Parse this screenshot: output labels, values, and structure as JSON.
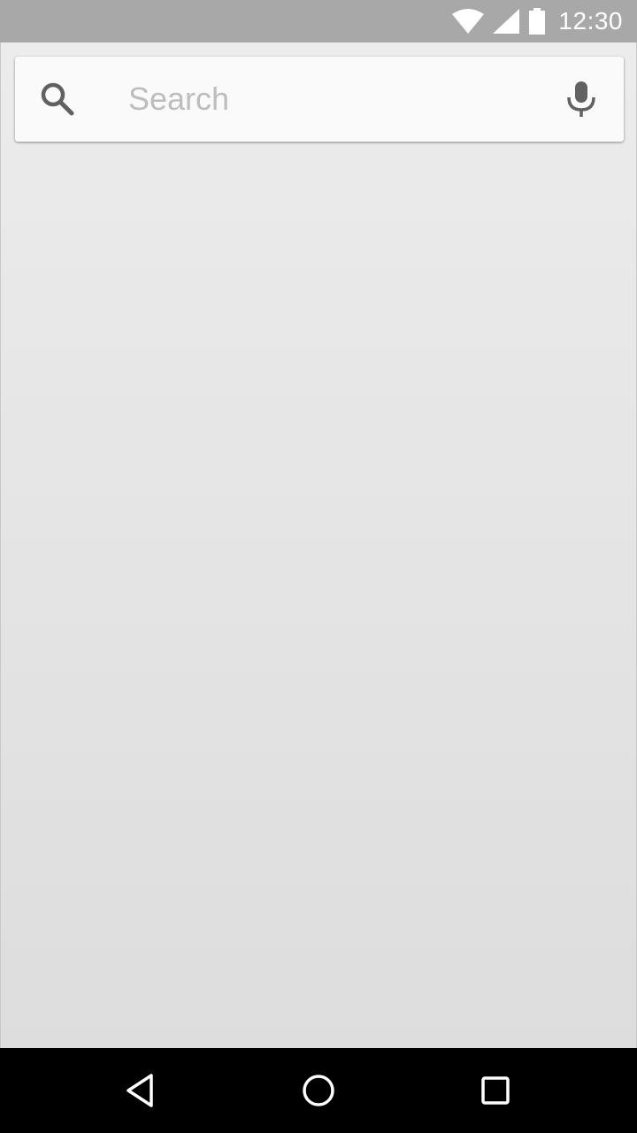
{
  "status_bar": {
    "time": "12:30",
    "icons": [
      "wifi-icon",
      "cellular-signal-icon",
      "battery-icon"
    ]
  },
  "search": {
    "placeholder": "Search",
    "value": "",
    "left_icon": "search-icon",
    "right_icon": "mic-icon"
  },
  "nav_bar": {
    "buttons": [
      "back-icon",
      "home-icon",
      "recents-icon"
    ]
  },
  "colors": {
    "status_bar": "#a8a8a8",
    "search_card": "#fafafa",
    "icon_gray": "#616161",
    "placeholder": "#bdbdbd",
    "nav_bar": "#000000"
  }
}
